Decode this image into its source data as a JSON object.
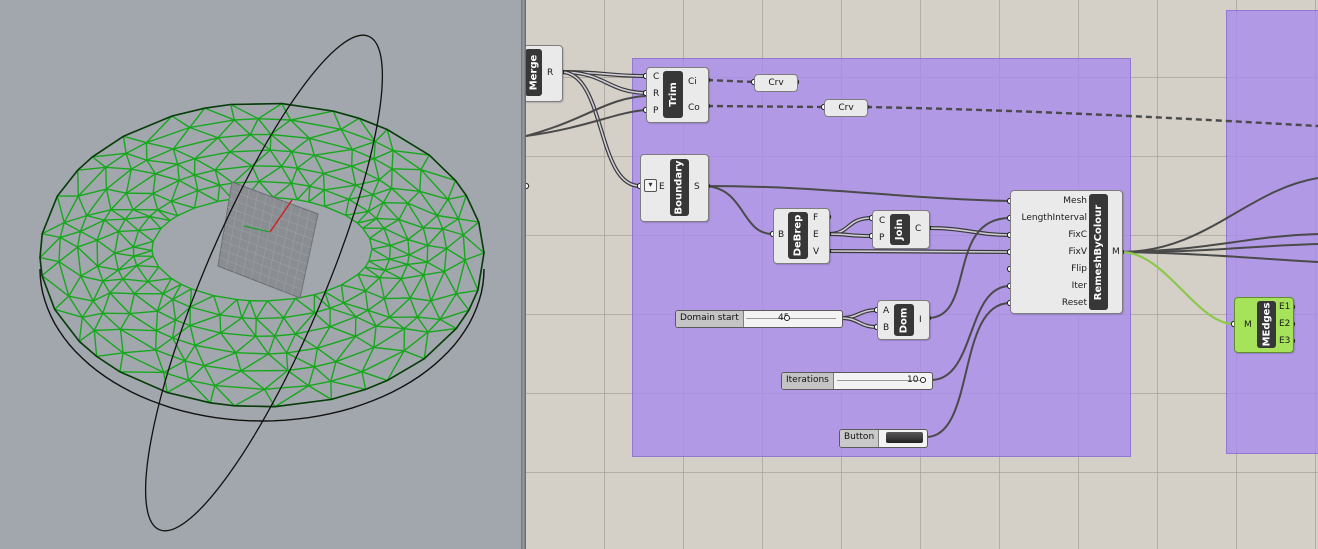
{
  "viewport": {
    "mesh_color": "#16a81c",
    "curve_color": "#111111",
    "bg_color": "#a2a7ad"
  },
  "canvas": {
    "group_color": "#aa8ceb",
    "components": {
      "merge": {
        "name": "Merge",
        "output": "R"
      },
      "trim": {
        "name": "Trim",
        "inputs": [
          "C",
          "R",
          "P"
        ],
        "outputs": [
          "Ci",
          "Co"
        ]
      },
      "crv1": {
        "label": "Crv"
      },
      "crv2": {
        "label": "Crv"
      },
      "boundary": {
        "name": "Boundary",
        "input": "E",
        "output": "S"
      },
      "debrep": {
        "name": "DeBrep",
        "input": "B",
        "outputs": [
          "F",
          "E",
          "V"
        ]
      },
      "join": {
        "name": "Join",
        "inputs": [
          "C",
          "P"
        ],
        "output": "C"
      },
      "remesh": {
        "name": "RemeshByColour",
        "inputs": [
          "Mesh",
          "LengthInterval",
          "FixC",
          "FixV",
          "Flip",
          "Iter",
          "Reset"
        ],
        "output": "M"
      },
      "dom": {
        "name": "Dom",
        "inputs": [
          "A",
          "B"
        ],
        "output": "I"
      },
      "medges": {
        "name": "MEdges",
        "input": "M",
        "outputs": [
          "E1",
          "E2",
          "E3"
        ]
      }
    },
    "sliders": {
      "domain_start": {
        "name": "Domain start",
        "value": "45",
        "fraction": 0.45
      },
      "iterations": {
        "name": "Iterations",
        "value": "10",
        "fraction": 1.0
      }
    },
    "button": {
      "name": "Button"
    }
  }
}
